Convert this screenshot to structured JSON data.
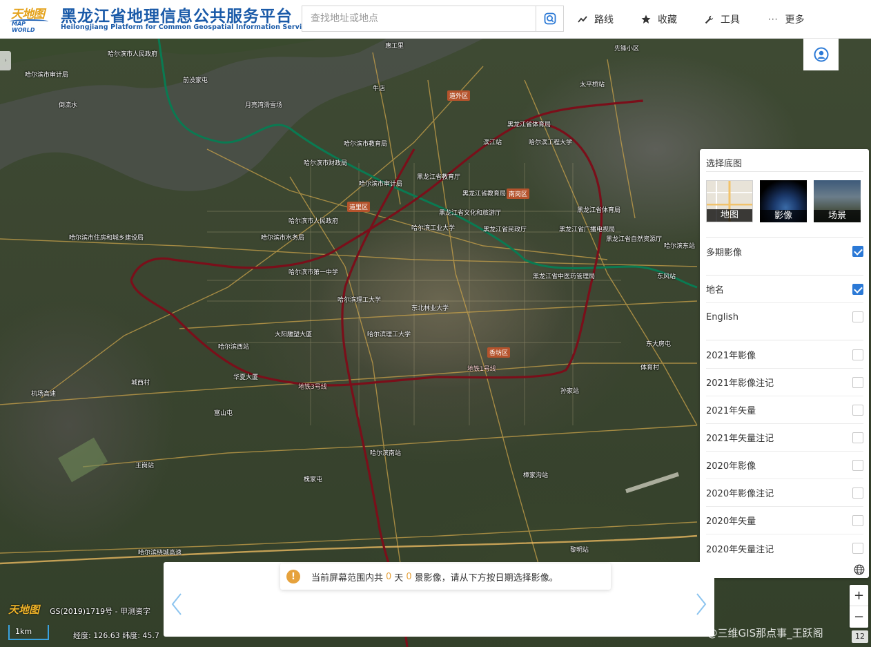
{
  "header": {
    "logo_cn": "天地图",
    "logo_en": "MAP WORLD",
    "title_cn": "黑龙江省地理信息公共服务平台",
    "title_en": "Heilongjiang Platform for Common Geospatial Information Services",
    "search_placeholder": "查找地址或地点",
    "nav": [
      {
        "label": "路线",
        "icon": "route-icon"
      },
      {
        "label": "收藏",
        "icon": "star-icon"
      },
      {
        "label": "工具",
        "icon": "wrench-icon"
      },
      {
        "label": "更多",
        "icon": "more-icon"
      }
    ]
  },
  "panel": {
    "title": "选择底图",
    "basemaps": [
      {
        "label": "地图",
        "icon": "map-thumbnail"
      },
      {
        "label": "影像",
        "icon": "imagery-thumbnail"
      },
      {
        "label": "场景",
        "icon": "scene-thumbnail"
      }
    ],
    "layers": [
      {
        "label": "多期影像",
        "checked": true
      },
      {
        "label": "地名",
        "checked": true
      },
      {
        "label": "English",
        "checked": false
      },
      {
        "label": "2021年影像",
        "checked": false
      },
      {
        "label": "2021年影像注记",
        "checked": false
      },
      {
        "label": "2021年矢量",
        "checked": false
      },
      {
        "label": "2021年矢量注记",
        "checked": false
      },
      {
        "label": "2020年影像",
        "checked": false
      },
      {
        "label": "2020年影像注记",
        "checked": false
      },
      {
        "label": "2020年矢量",
        "checked": false
      },
      {
        "label": "2020年矢量注记",
        "checked": false
      }
    ]
  },
  "notice": {
    "prefix": "当前屏幕范围内共",
    "days": "0",
    "mid": "天",
    "scenes": "0",
    "suffix": "景影像，请从下方按日期选择影像。"
  },
  "zoom": {
    "in": "+",
    "out": "−",
    "level": "12"
  },
  "footer": {
    "logo": "天地图",
    "copyright": "GS(2019)1719号 - 甲测资字",
    "scale": "1km",
    "coords": "经度: 126.63  纬度: 45.7"
  },
  "watermark": "CSDN @三维GIS那点事_王跃阁",
  "map": {
    "districts": [
      "道外区",
      "南岗区",
      "道里区",
      "香坊区"
    ],
    "labels": [
      "哈尔滨市人民政府",
      "哈尔滨市审计局",
      "前没家屯",
      "倒流水",
      "月亮湾滑雪场",
      "惠工里",
      "牛店",
      "太平桥站",
      "先锋小区",
      "哈尔滨市教育局",
      "滨江站",
      "黑龙江省体育局",
      "哈尔滨工程大学",
      "哈尔滨市财政局",
      "黑龙江省教育厅",
      "黑龙江省教育局",
      "哈尔滨市审计局",
      "哈尔滨市人民政府",
      "黑龙江省文化和旅游厅",
      "黑龙江省民政厅",
      "哈尔滨工业大学",
      "黑龙江省体育局",
      "黑龙江省广播电视局",
      "黑龙江省自然资源厅",
      "哈尔滨市住房和城乡建设局",
      "哈尔滨市水务局",
      "黑龙江省中医药管理局",
      "哈尔滨市第一中学",
      "哈尔滨理工大学",
      "东北林业大学",
      "哈尔滨理工大学",
      "哈尔滨西站",
      "大阳雕塑大厦",
      "华夏大厦",
      "城西村",
      "机场高速",
      "富山屯",
      "哈尔滨南站",
      "哈尔滨绕城高速",
      "王岗站",
      "黎明站",
      "槐家屯",
      "樟家沟站",
      "东风站",
      "哈尔滨东站",
      "孙家站",
      "体育村",
      "东大房屯"
    ],
    "metro": [
      "地铁1号线",
      "地铁3号线"
    ]
  }
}
